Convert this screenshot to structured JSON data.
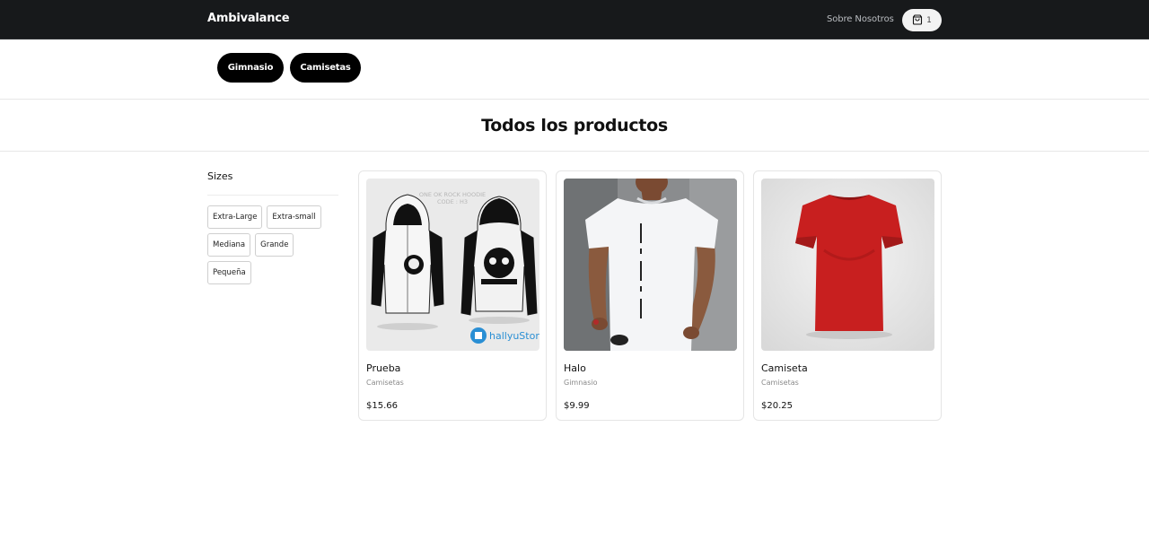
{
  "header": {
    "brand": "Ambivalance",
    "about_label": "Sobre Nosotros",
    "cart_icon": "shopping-bag-icon",
    "cart_count": "1"
  },
  "categories": [
    {
      "label": "Gimnasio"
    },
    {
      "label": "Camisetas"
    }
  ],
  "page": {
    "title": "Todos los productos"
  },
  "filters": {
    "title": "Sizes",
    "sizes": [
      "Extra-Large",
      "Extra-small",
      "Mediana",
      "Grande",
      "Pequeña"
    ]
  },
  "products": [
    {
      "name": "Prueba",
      "category": "Camisetas",
      "price": "$15.66",
      "image": "hoodie-front-back"
    },
    {
      "name": "Halo",
      "category": "Gimnasio",
      "price": "$9.99",
      "image": "man-white-tshirt"
    },
    {
      "name": "Camiseta",
      "category": "Camisetas",
      "price": "$20.25",
      "image": "red-tshirt"
    }
  ],
  "colors": {
    "navbar_bg": "#17191b",
    "pill_bg": "#000000",
    "shirt_red": "#c81f1f"
  }
}
